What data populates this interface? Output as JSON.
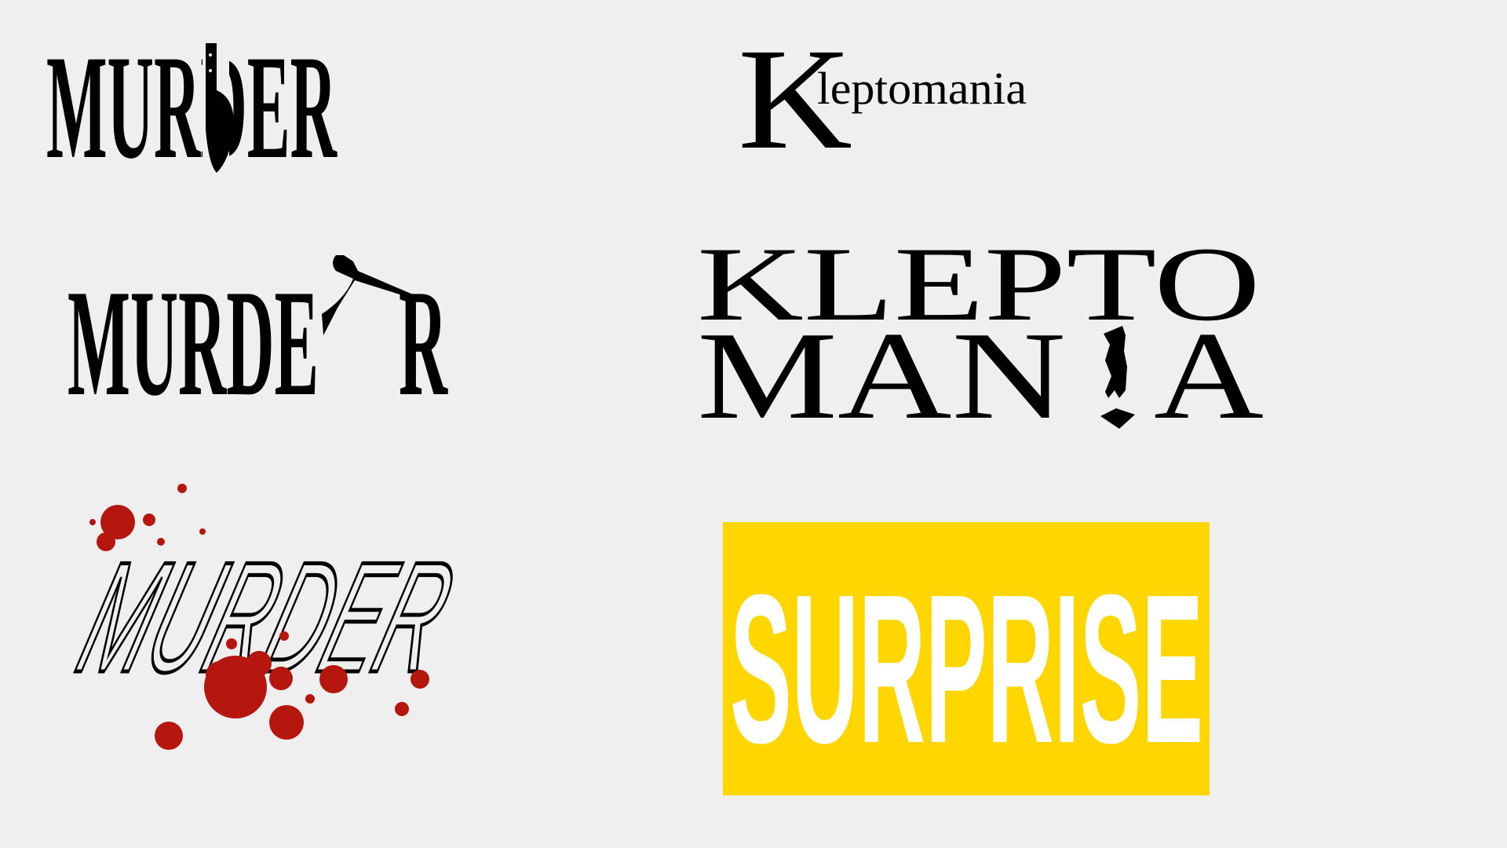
{
  "logos": {
    "murder_knife": {
      "text": "MURDER"
    },
    "kleptomania_small": {
      "initial": "K",
      "rest": "leptomania"
    },
    "murder_stab": {
      "left": "MURDE",
      "right": "R"
    },
    "kleptomania_large": {
      "line1": "KLEPTO",
      "line2_left": "MAN",
      "line2_right": "A"
    },
    "murder_blood": {
      "text": "MURDER"
    },
    "surprise": {
      "text": "SURPRISE",
      "background": "#FFD600"
    }
  },
  "colors": {
    "ink": "#000000",
    "blood": "#B5170F",
    "background": "#EFEFEF"
  }
}
